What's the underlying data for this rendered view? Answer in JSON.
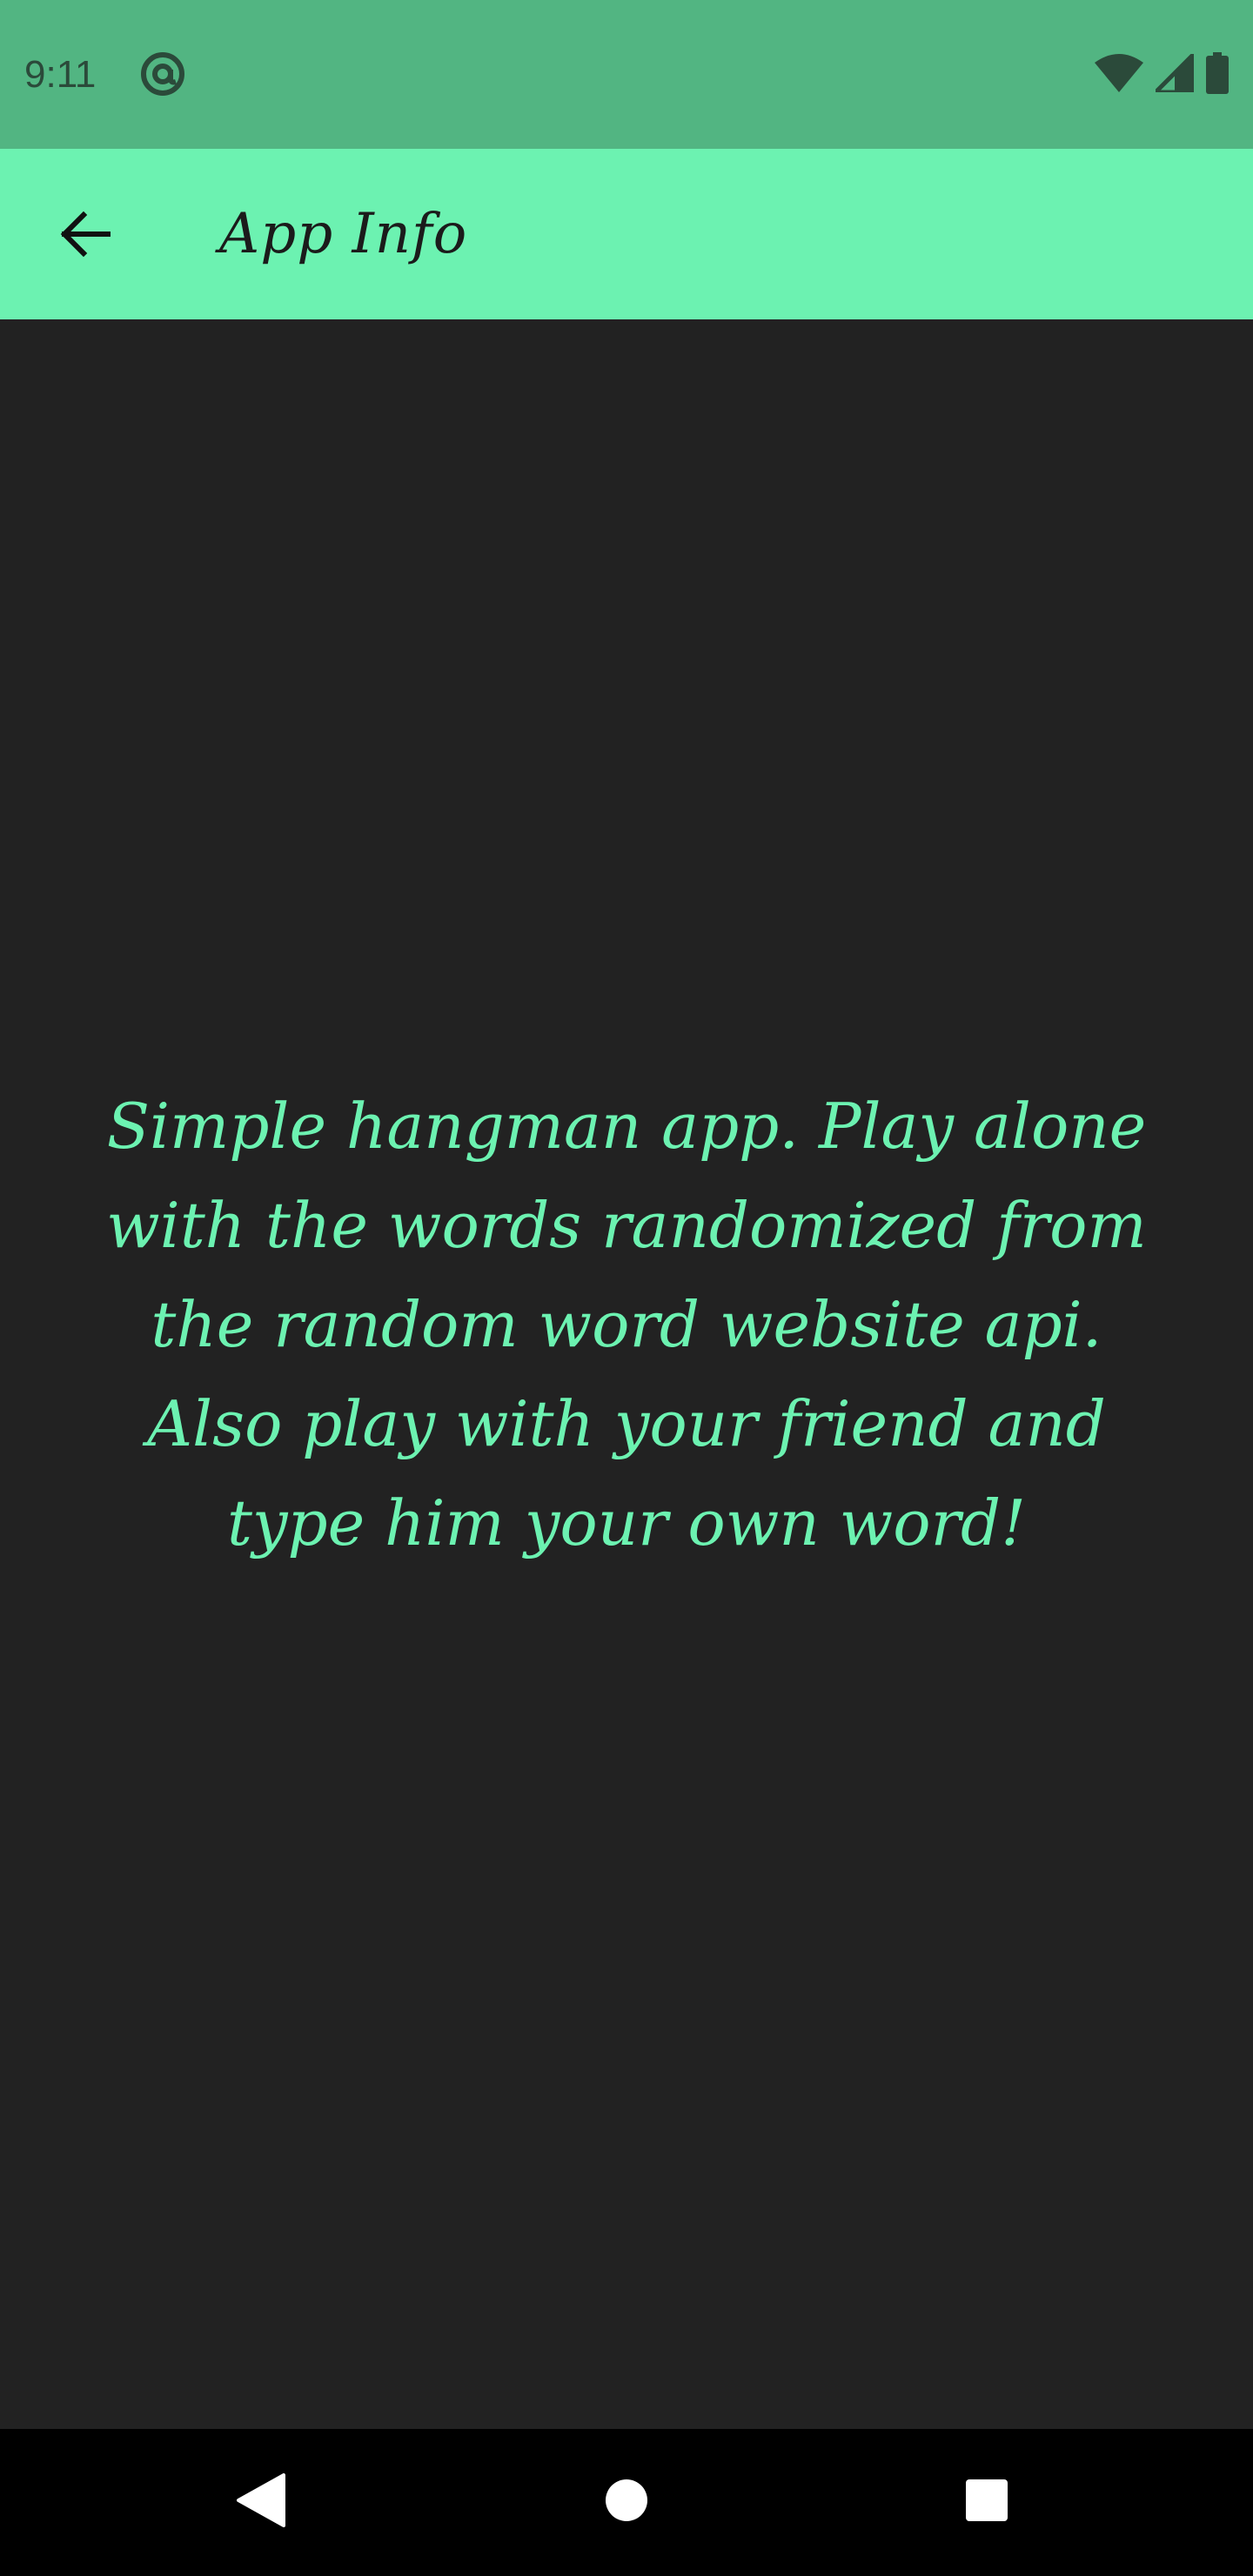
{
  "status_bar": {
    "time": "9:11",
    "app_icon": "at-sign-icon",
    "wifi_icon": "wifi-icon",
    "signal_icon": "cellular-signal-icon",
    "battery_icon": "battery-icon",
    "background_color": "#52b582"
  },
  "app_bar": {
    "back_icon": "arrow-back-icon",
    "title": "App Info",
    "background_color": "#6cf2b1"
  },
  "content": {
    "description": "Simple hangman app. Play alone with the words randomized from the random word website api. Also play with your friend and type him your own word!",
    "text_color": "#6cf2b1",
    "background_color": "#222222"
  },
  "nav_bar": {
    "back_icon": "nav-back-triangle-icon",
    "home_icon": "nav-home-circle-icon",
    "recents_icon": "nav-recents-square-icon"
  }
}
